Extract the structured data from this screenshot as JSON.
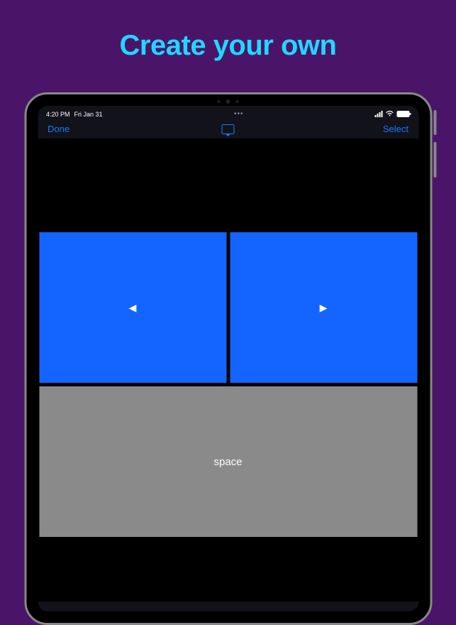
{
  "headline": "Create your own",
  "status_bar": {
    "time": "4:20 PM",
    "date": "Fri Jan 31",
    "dots": "•••"
  },
  "nav_bar": {
    "done_label": "Done",
    "select_label": "Select"
  },
  "buttons": {
    "left_arrow": "◀",
    "right_arrow": "▶",
    "space_label": "space"
  }
}
